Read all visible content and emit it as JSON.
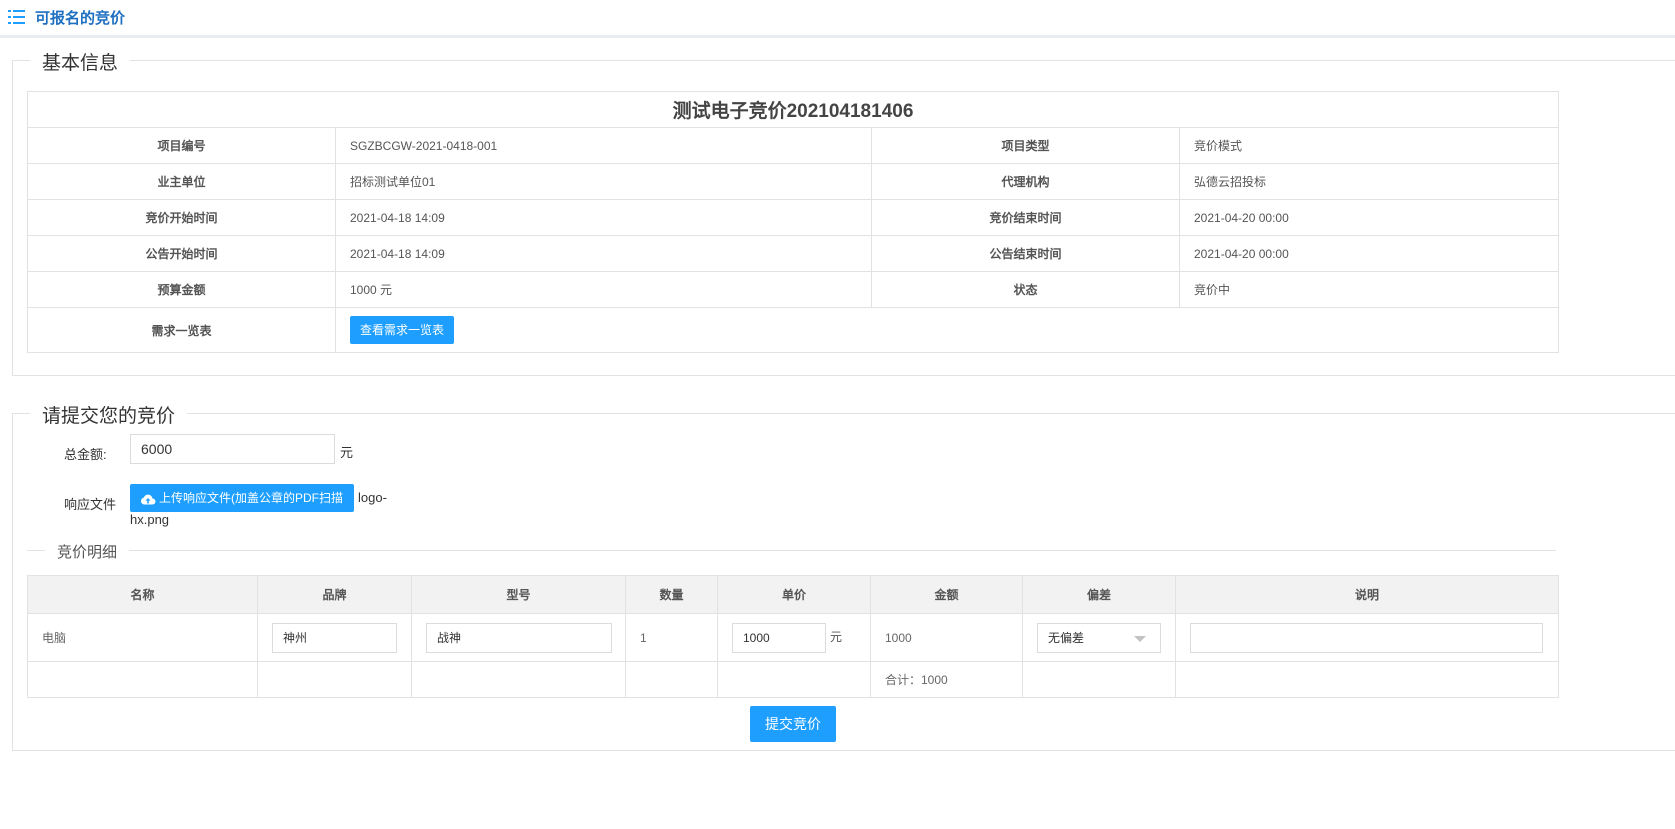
{
  "header": {
    "title": "可报名的竞价",
    "icon": "list-icon"
  },
  "basic_info": {
    "legend": "基本信息",
    "project_title": "测试电子竞价202104181406",
    "rows": [
      {
        "label1": "项目编号",
        "value1": "SGZBCGW-2021-0418-001",
        "label2": "项目类型",
        "value2": "竞价模式"
      },
      {
        "label1": "业主单位",
        "value1": "招标测试单位01",
        "label2": "代理机构",
        "value2": "弘德云招投标"
      },
      {
        "label1": "竞价开始时间",
        "value1": "2021-04-18 14:09",
        "label2": "竞价结束时间",
        "value2": "2021-04-20 00:00"
      },
      {
        "label1": "公告开始时间",
        "value1": "2021-04-18 14:09",
        "label2": "公告结束时间",
        "value2": "2021-04-20 00:00"
      },
      {
        "label1": "预算金额",
        "value1": "1000 元",
        "label2": "状态",
        "value2": "竞价中"
      }
    ],
    "requirement_label": "需求一览表",
    "requirement_button": "查看需求一览表"
  },
  "submit": {
    "legend": "请提交您的竞价",
    "amount_label": "总金额:",
    "amount_value": "6000",
    "amount_unit": "元",
    "file_label": "响应文件",
    "upload_button": "上传响应文件(加盖公章的PDF扫描件)",
    "file_name_part1": "logo-",
    "file_name_part2": "hx.png",
    "detail_legend": "竞价明细",
    "columns": [
      "名称",
      "品牌",
      "型号",
      "数量",
      "单价",
      "金额",
      "偏差",
      "说明"
    ],
    "item": {
      "name": "电脑",
      "brand": "神州",
      "model": "战神",
      "quantity": "1",
      "unit_price": "1000",
      "unit_price_unit": "元",
      "amount": "1000",
      "deviation": "无偏差",
      "note": ""
    },
    "total": "合计：1000",
    "submit_button": "提交竞价"
  },
  "colors": {
    "accent": "#1e9fff",
    "title": "#1e6fc2",
    "border": "#e2e2e2",
    "header_bg": "#f2f2f2"
  }
}
